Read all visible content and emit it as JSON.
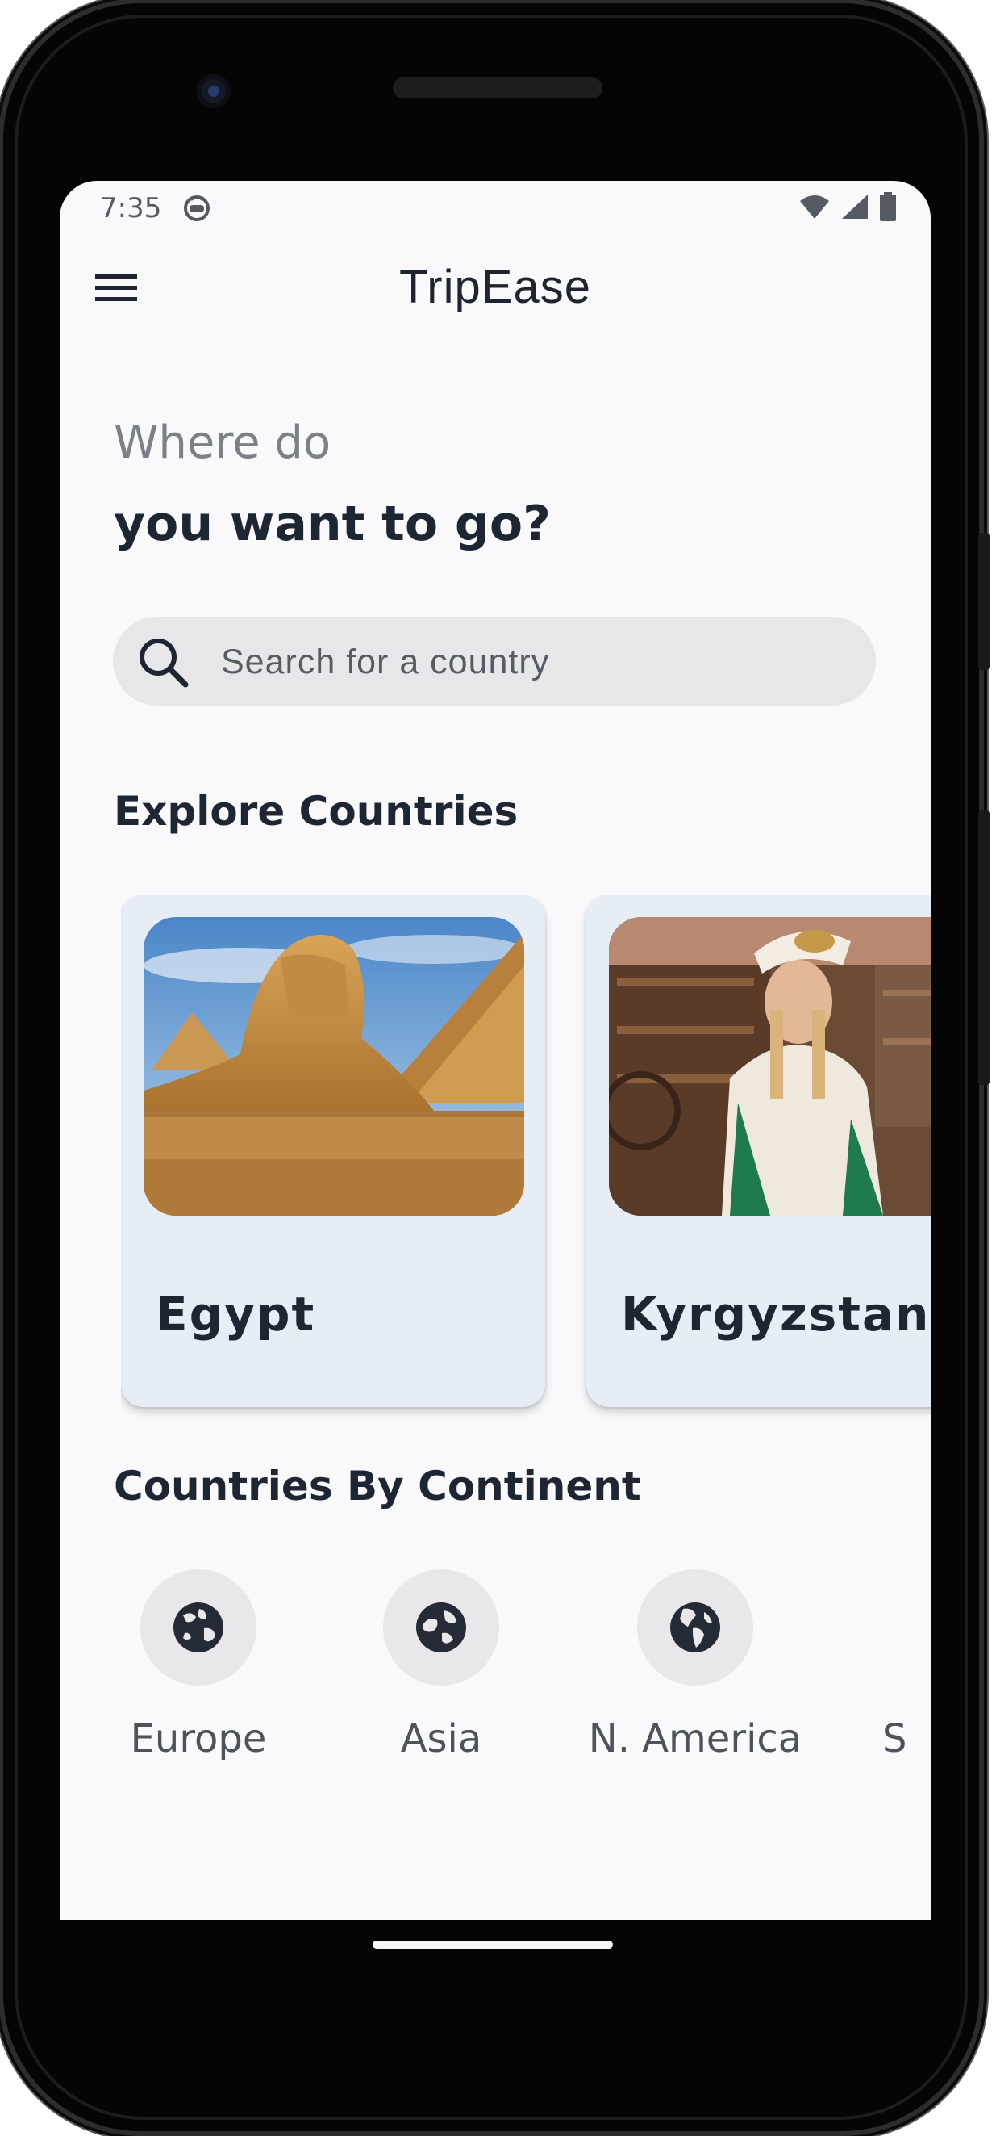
{
  "status_bar": {
    "time": "7:35",
    "icons": [
      "robot-icon",
      "wifi-icon",
      "signal-icon",
      "battery-icon"
    ]
  },
  "app_bar": {
    "title": "TripEase",
    "menu_icon": "menu-icon"
  },
  "greeting": {
    "line1": "Where do",
    "line2": "you want to go?"
  },
  "search": {
    "placeholder": "Search for a country",
    "value": "",
    "icon": "search-icon"
  },
  "explore": {
    "title": "Explore Countries",
    "cards": [
      {
        "label": "Egypt",
        "image": "sphinx-and-pyramids-photo"
      },
      {
        "label": "Kyrgyzstan",
        "image": "woman-in-traditional-dress-photo"
      }
    ]
  },
  "continents": {
    "title": "Countries By Continent",
    "items": [
      {
        "label": "Europe",
        "icon": "globe-europe-icon"
      },
      {
        "label": "Asia",
        "icon": "globe-asia-icon"
      },
      {
        "label": "N. America",
        "icon": "globe-americas-icon"
      },
      {
        "label": "S",
        "icon": "globe-icon"
      }
    ]
  },
  "colors": {
    "screen_background": "#f9f9fb",
    "card_background": "#e7edf4",
    "search_background": "#e7e7ea",
    "heading_text": "#1f2633",
    "muted_text": "#7b8089"
  }
}
